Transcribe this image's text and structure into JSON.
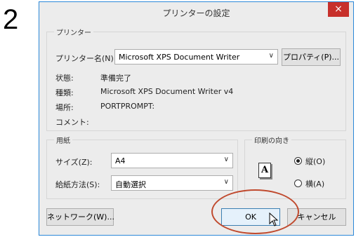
{
  "step": {
    "number": "2"
  },
  "dialog": {
    "title": "プリンターの設定",
    "close": "×"
  },
  "printer": {
    "group_label": "プリンター",
    "name_label": "プリンター名(N):",
    "name_value": "Microsoft XPS Document Writer",
    "properties_button": "プロパティ(P)...",
    "status_label": "状態:",
    "status_value": "準備完了",
    "type_label": "種類:",
    "type_value": "Microsoft XPS Document Writer v4",
    "where_label": "場所:",
    "where_value": "PORTPROMPT:",
    "comment_label": "コメント:",
    "comment_value": ""
  },
  "paper": {
    "group_label": "用紙",
    "size_label": "サイズ(Z):",
    "size_value": "A4",
    "source_label": "給紙方法(S):",
    "source_value": "自動選択"
  },
  "orientation": {
    "group_label": "印刷の向き",
    "icon_letter": "A",
    "portrait_label": "縦(O)",
    "landscape_label": "横(A)",
    "selected": "portrait"
  },
  "footer": {
    "network_button": "ネットワーク(W)...",
    "ok_button": "OK",
    "cancel_button": "キャンセル"
  },
  "colors": {
    "accent_border": "#2a87d8",
    "close_button": "#c7302b",
    "highlight_ellipse": "#c04a2e"
  }
}
